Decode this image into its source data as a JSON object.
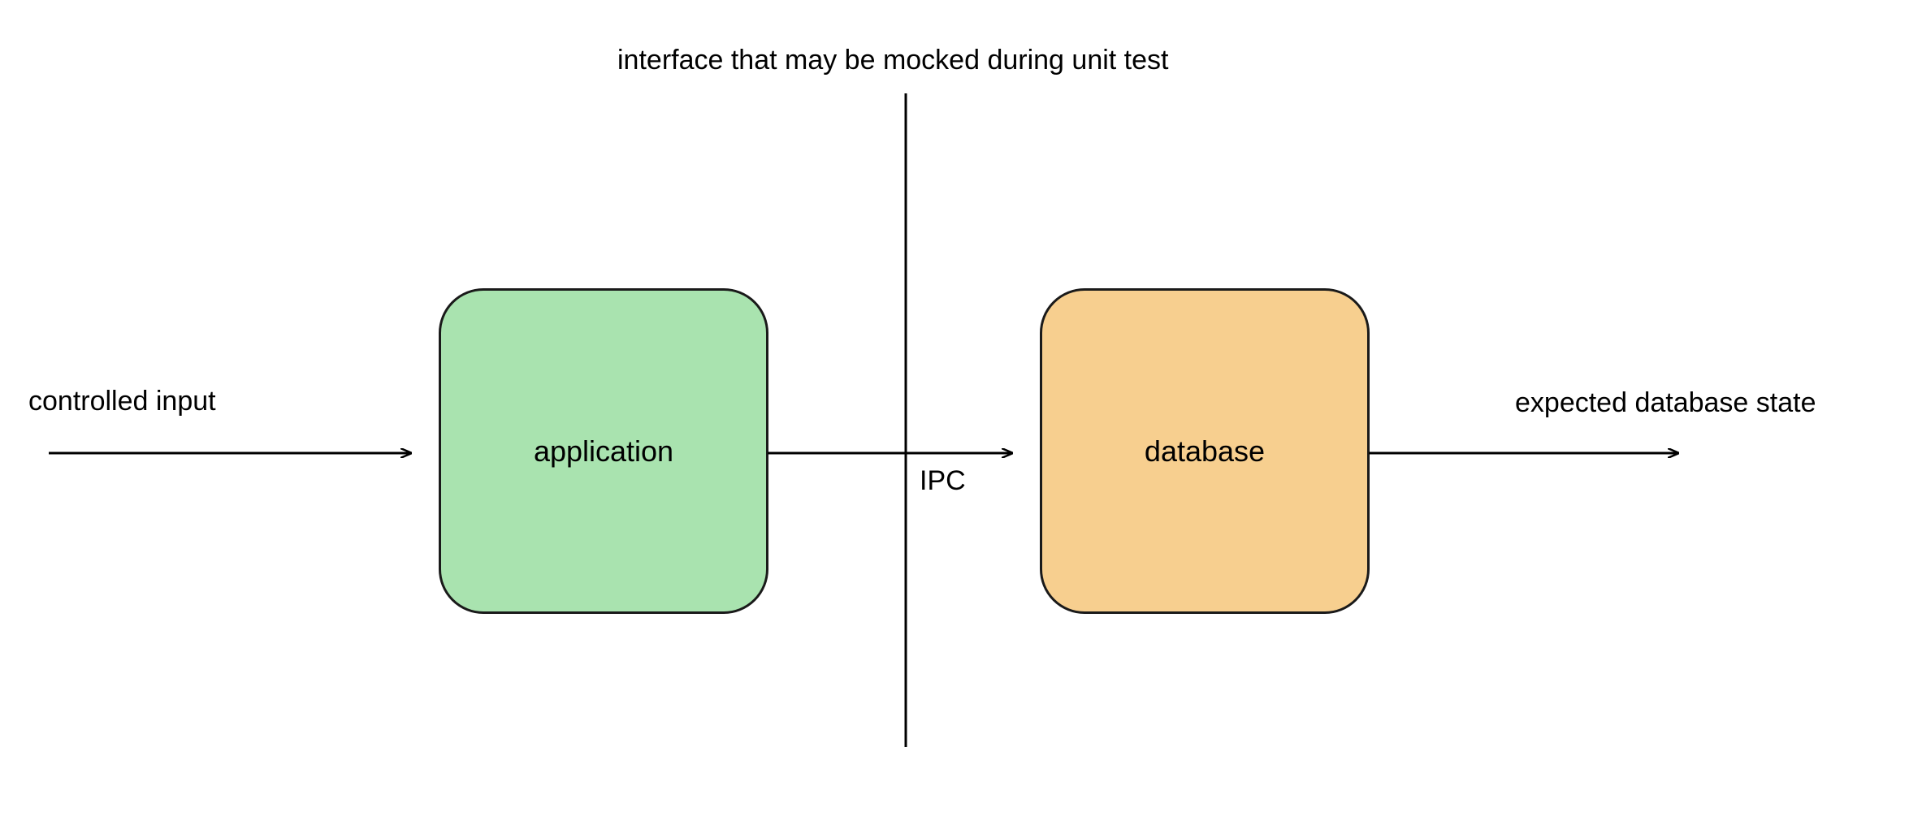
{
  "labels": {
    "top_caption": "interface that may be mocked during unit test",
    "input_label": "controlled input",
    "output_label": "expected database state",
    "ipc_label": "IPC"
  },
  "nodes": {
    "application": {
      "label": "application",
      "fill": "#a9e3af",
      "stroke": "#1a1a1a"
    },
    "database": {
      "label": "database",
      "fill": "#f7cf8f",
      "stroke": "#1a1a1a"
    }
  }
}
